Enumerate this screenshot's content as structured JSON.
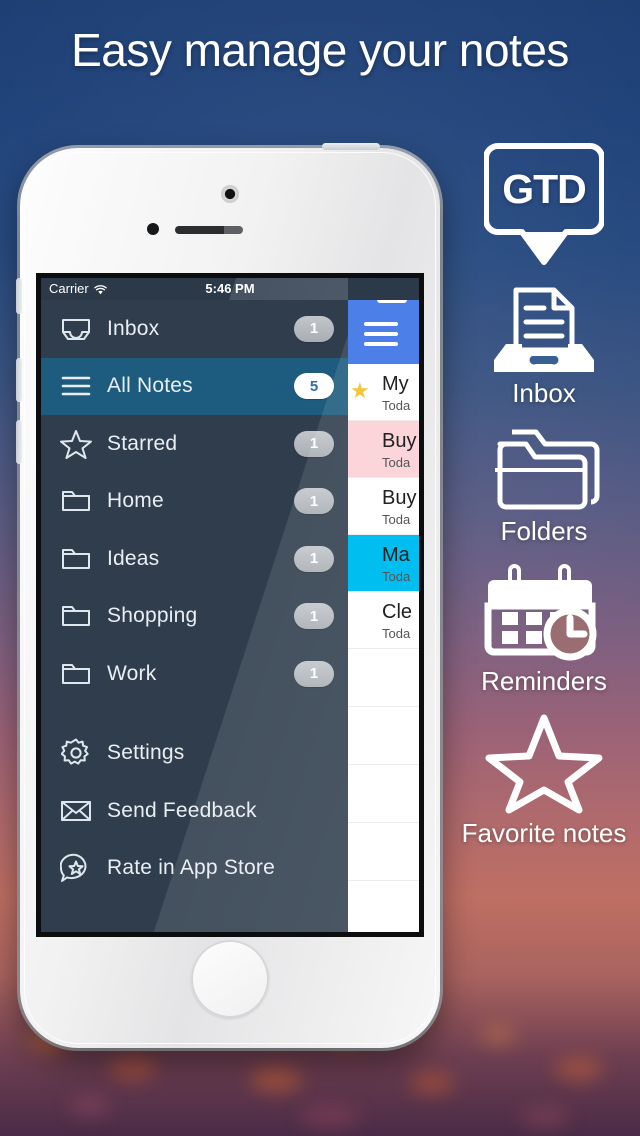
{
  "headline": "Easy manage your notes",
  "phone": {
    "status_bar": {
      "carrier": "Carrier",
      "wifi_icon": "wifi-icon",
      "time": "5:46 PM",
      "battery_icon": "battery-icon"
    },
    "sidebar": {
      "items": [
        {
          "label": "Inbox",
          "badge": "1",
          "icon": "inbox-tray-icon",
          "selected": false
        },
        {
          "label": "All Notes",
          "badge": "5",
          "icon": "hamburger-icon",
          "selected": true
        },
        {
          "label": "Starred",
          "badge": "1",
          "icon": "star-icon",
          "selected": false
        },
        {
          "label": "Home",
          "badge": "1",
          "icon": "folder-icon",
          "selected": false
        },
        {
          "label": "Ideas",
          "badge": "1",
          "icon": "folder-icon",
          "selected": false
        },
        {
          "label": "Shopping",
          "badge": "1",
          "icon": "folder-icon",
          "selected": false
        },
        {
          "label": "Work",
          "badge": "1",
          "icon": "folder-icon",
          "selected": false
        }
      ],
      "footer_items": [
        {
          "label": "Settings",
          "icon": "gear-icon"
        },
        {
          "label": "Send Feedback",
          "icon": "envelope-icon"
        },
        {
          "label": "Rate in App Store",
          "icon": "speech-bubble-star-icon"
        }
      ]
    },
    "notes_panel": {
      "nav_icon": "hamburger-icon",
      "rows": [
        {
          "title": "My",
          "subtitle": "Toda",
          "color": "#ffffff",
          "starred": true
        },
        {
          "title": "Buy",
          "subtitle": "Toda",
          "color": "#fbd5d9",
          "starred": false
        },
        {
          "title": "Buy",
          "subtitle": "Toda",
          "color": "#ffffff",
          "starred": false
        },
        {
          "title": "Ma",
          "subtitle": "Toda",
          "color": "#00bff0",
          "starred": false
        },
        {
          "title": "Cle",
          "subtitle": "Toda",
          "color": "#ffffff",
          "starred": false
        }
      ]
    }
  },
  "features": [
    {
      "label": "",
      "icon": "gtd-badge-icon",
      "badge_text": "GTD"
    },
    {
      "label": "Inbox",
      "icon": "inbox-tray-icon"
    },
    {
      "label": "Folders",
      "icon": "folders-icon"
    },
    {
      "label": "Reminders",
      "icon": "calendar-clock-icon"
    },
    {
      "label": "Favorite notes",
      "icon": "star-outline-icon"
    }
  ],
  "colors": {
    "accent_blue": "#4c80e8",
    "selected_row": "#1d5c7e",
    "sidebar_bg": "#2f3d4c",
    "note_pink": "#fbd5d9",
    "note_cyan": "#00bff0",
    "star_yellow": "#f4c63d"
  }
}
